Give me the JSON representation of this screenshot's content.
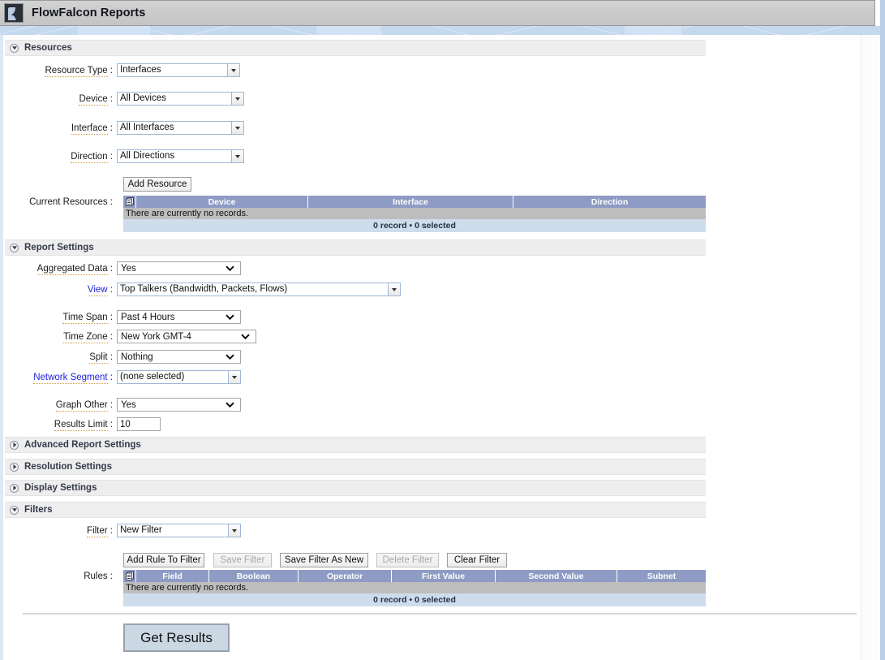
{
  "window": {
    "title": "FlowFalcon Reports",
    "icon": "falcon-logo-icon"
  },
  "sections": {
    "resources": {
      "title": "Resources",
      "expanded": true,
      "twisty": "chevron-down-icon"
    },
    "report_settings": {
      "title": "Report Settings",
      "expanded": true,
      "twisty": "chevron-down-icon"
    },
    "advanced_report_settings": {
      "title": "Advanced Report Settings",
      "expanded": false,
      "twisty": "chevron-right-icon"
    },
    "resolution_settings": {
      "title": "Resolution Settings",
      "expanded": false,
      "twisty": "chevron-right-icon"
    },
    "display_settings": {
      "title": "Display Settings",
      "expanded": false,
      "twisty": "chevron-right-icon"
    },
    "filters": {
      "title": "Filters",
      "expanded": true,
      "twisty": "chevron-down-icon"
    }
  },
  "resources": {
    "resource_type": {
      "label": "Resource Type",
      "value": "Interfaces"
    },
    "device": {
      "label": "Device",
      "value": "All Devices"
    },
    "interface": {
      "label": "Interface",
      "value": "All Interfaces"
    },
    "direction": {
      "label": "Direction",
      "value": "All Directions"
    },
    "add_resource_button": "Add Resource",
    "current_resources_label": "Current Resources",
    "table": {
      "columns": [
        "Device",
        "Interface",
        "Direction"
      ],
      "empty_message": "There are currently no records.",
      "footer": "0 record • 0 selected"
    }
  },
  "report_settings": {
    "aggregated_data": {
      "label": "Aggregated Data",
      "value": "Yes"
    },
    "view": {
      "label": "View",
      "value": "Top Talkers (Bandwidth, Packets, Flows)"
    },
    "time_span": {
      "label": "Time Span",
      "value": "Past 4 Hours"
    },
    "time_zone": {
      "label": "Time Zone",
      "value": "New York GMT-4"
    },
    "split": {
      "label": "Split",
      "value": "Nothing"
    },
    "network_segment": {
      "label": "Network Segment",
      "value": "(none selected)"
    },
    "graph_other": {
      "label": "Graph Other",
      "value": "Yes"
    },
    "results_limit": {
      "label": "Results Limit",
      "value": "10"
    }
  },
  "filters": {
    "filter": {
      "label": "Filter",
      "value": "New Filter"
    },
    "buttons": [
      {
        "label": "Add Rule To Filter",
        "disabled": false
      },
      {
        "label": "Save Filter",
        "disabled": true
      },
      {
        "label": "Save Filter As New",
        "disabled": false
      },
      {
        "label": "Delete Filter",
        "disabled": true
      },
      {
        "label": "Clear Filter",
        "disabled": false
      }
    ],
    "rules_label": "Rules",
    "table": {
      "columns": [
        "Field",
        "Boolean",
        "Operator",
        "First Value",
        "Second Value",
        "Subnet"
      ],
      "empty_message": "There are currently no records.",
      "footer": "0 record • 0 selected"
    }
  },
  "actions": {
    "get_results_button": "Get Results"
  },
  "colors": {
    "table_header": "#8e9bc4",
    "table_footer": "#cfdcec",
    "empty_row": "#bdbdbd",
    "section_bar": "#eeeeee",
    "banner": "#c4d8ee",
    "primary_button": "#ccd7e4",
    "link_text": "#2222dd",
    "label_underline": "#d79a3c"
  }
}
